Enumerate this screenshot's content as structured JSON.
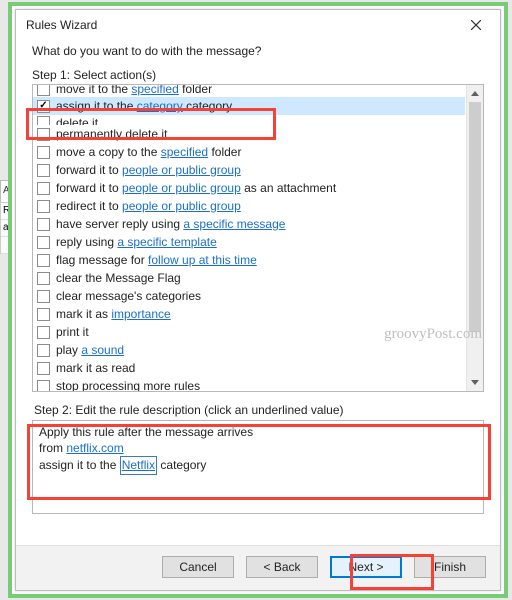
{
  "window": {
    "title": "Rules Wizard",
    "question": "What do you want to do with the message?",
    "step1_label": "Step 1: Select action(s)",
    "step2_label": "Step 2: Edit the rule description (click an underlined value)"
  },
  "bg": {
    "ale": "Ale",
    "r1": "Rı",
    "r2": "a|"
  },
  "actions": [
    {
      "checked": false,
      "pre": "move it to the ",
      "link": "specified",
      "post": " folder",
      "cutoff": true
    },
    {
      "checked": true,
      "pre": "assign it to the ",
      "link": "category",
      "post": " category",
      "selected": true
    },
    {
      "checked": false,
      "pre": "delete it",
      "cutoff_text": true
    },
    {
      "checked": false,
      "pre": "permanently delete it"
    },
    {
      "checked": false,
      "pre": "move a copy to the ",
      "link": "specified",
      "post": " folder"
    },
    {
      "checked": false,
      "pre": "forward it to ",
      "link": "people or public group"
    },
    {
      "checked": false,
      "pre": "forward it to ",
      "link": "people or public group",
      "post": " as an attachment"
    },
    {
      "checked": false,
      "pre": "redirect it to ",
      "link": "people or public group"
    },
    {
      "checked": false,
      "pre": "have server reply using ",
      "link": "a specific message"
    },
    {
      "checked": false,
      "pre": "reply using ",
      "link": "a specific template"
    },
    {
      "checked": false,
      "pre": "flag message for ",
      "link": "follow up at this time"
    },
    {
      "checked": false,
      "pre": "clear the Message Flag"
    },
    {
      "checked": false,
      "pre": "clear message's categories"
    },
    {
      "checked": false,
      "pre": "mark it as ",
      "link": "importance"
    },
    {
      "checked": false,
      "pre": "print it"
    },
    {
      "checked": false,
      "pre": "play ",
      "link": "a sound"
    },
    {
      "checked": false,
      "pre": "mark it as read"
    },
    {
      "checked": false,
      "pre": "stop processing more rules"
    }
  ],
  "description": {
    "line1": "Apply this rule after the message arrives",
    "line2_pre": "from ",
    "line2_link": "netflix.com",
    "line3_pre": "assign it to the ",
    "line3_box": "Netflix",
    "line3_post": " category"
  },
  "buttons": {
    "cancel": "Cancel",
    "back": "< Back",
    "next": "Next >",
    "finish": "Finish"
  },
  "watermark": "groovyPost.com"
}
